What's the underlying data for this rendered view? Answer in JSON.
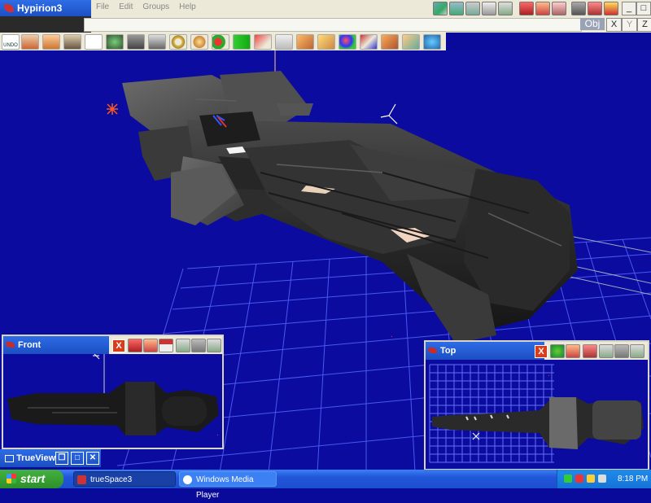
{
  "app": {
    "title": "Hypirion3"
  },
  "menu": [
    "File",
    "Edit",
    "Groups",
    "Help"
  ],
  "top_icons": [
    "camera-icon",
    "landscape-icon",
    "plants-icon",
    "bones-icon",
    "figure-icon",
    "3dr-icon",
    "render-icon",
    "render-options-icon",
    "monitor-icon",
    "flag-icon",
    "help-icon"
  ],
  "window_controls": {
    "minimize": "_",
    "maximize": "□",
    "close": "X"
  },
  "object_bar": {
    "obj_label": "Obj",
    "axes": [
      "X",
      "Y",
      "Z"
    ]
  },
  "toolbar": {
    "undo_label": "UNDO",
    "tools": [
      "link-icon",
      "cube-icon",
      "stack-icon",
      "pointer-icon",
      "eye-move-icon",
      "arrow-down-icon",
      "box-icon",
      "torus-icon",
      "sphere-icon",
      "balls-icon",
      "dumbbell-icon",
      "joint-icon",
      "path-icon",
      "bar-icon",
      "pencil-icon",
      "spheres-icon",
      "axis-icon",
      "paint-icon",
      "wrap-icon",
      "3d-icon"
    ]
  },
  "panels": {
    "front": {
      "title": "Front",
      "close": "X",
      "icons": [
        "3dr-icon",
        "render-icon",
        "house-icon",
        "tool-icon",
        "grid-icon",
        "figure-icon"
      ]
    },
    "top": {
      "title": "Top",
      "close": "X",
      "icons": [
        "globe-icon",
        "render-icon",
        "flag-icon",
        "tool-icon",
        "grid-icon",
        "figure-icon"
      ]
    }
  },
  "trueview": {
    "title": "TrueView",
    "buttons": [
      "restore",
      "maximize",
      "close"
    ]
  },
  "taskbar": {
    "start_label": "start",
    "tasks": [
      {
        "label": "trueSpace3",
        "active": true
      },
      {
        "label": "Windows Media Player",
        "active": false
      }
    ],
    "clock": "8:18 PM"
  },
  "colors": {
    "viewport_bg": "#0b0ba0",
    "grid": "#5566ff",
    "accent": "#d93c1a"
  }
}
